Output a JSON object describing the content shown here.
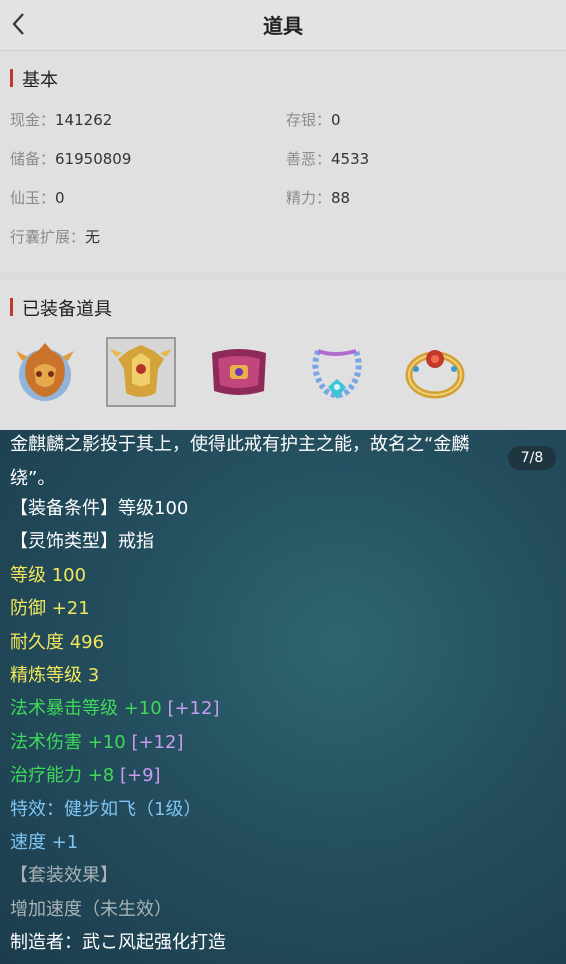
{
  "nav": {
    "title": "道具"
  },
  "basic": {
    "title": "基本",
    "stats": [
      {
        "key": "现金：",
        "value": "141262"
      },
      {
        "key": "存银：",
        "value": "0"
      },
      {
        "key": "储备：",
        "value": "61950809"
      },
      {
        "key": "善恶：",
        "value": "4533"
      },
      {
        "key": "仙玉：",
        "value": "0"
      },
      {
        "key": "精力：",
        "value": "88"
      },
      {
        "key": "行囊扩展：",
        "value": "无"
      }
    ]
  },
  "equip": {
    "title": "已装备道具",
    "items": [
      {
        "icon": "helmet-icon"
      },
      {
        "icon": "armor-icon"
      },
      {
        "icon": "belt-icon"
      },
      {
        "icon": "necklace-icon"
      },
      {
        "icon": "ring-icon"
      }
    ]
  },
  "tooltip": {
    "page": "7/8",
    "desc_line1": "金麒麟之影投于其上，使得此戒有护主之能，故名之“金麟",
    "desc_line2": "绕”。",
    "cond": "【装备条件】等级100",
    "type": "【灵饰类型】戒指",
    "level": "等级 100",
    "defense": "防御 +21",
    "durability": "耐久度 496",
    "refine": "精炼等级 3",
    "crit": {
      "base": "法术暴击等级 +10",
      "bonus": "[+12]"
    },
    "magic_dmg": {
      "base": "法术伤害 +10",
      "bonus": "[+12]"
    },
    "heal": {
      "base": "治疗能力 +8",
      "bonus": "[+9]"
    },
    "special": "特效：健步如飞（1级）",
    "speed": "速度 +1",
    "set_title": "【套装效果】",
    "set_effect": "增加速度（未生效）",
    "maker": "制造者：武こ风起强化打造"
  },
  "colors": {
    "panel_bg": "#244f5f",
    "yellow": "#f2e75a",
    "green": "#3fd85a",
    "purple": "#c79cf2",
    "blue": "#7fc4f2",
    "accent_bar": "#c0392b"
  }
}
